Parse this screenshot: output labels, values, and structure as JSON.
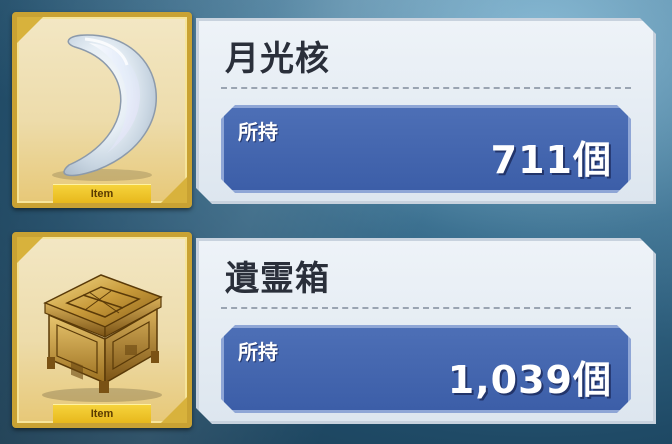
{
  "items": [
    {
      "name": "月光核",
      "tag": "Item",
      "owned_label": "所持",
      "owned_count": "711個",
      "icon": "crescent-moon-crystal-icon"
    },
    {
      "name": "遺霊箱",
      "tag": "Item",
      "owned_label": "所持",
      "owned_count": "1,039個",
      "icon": "golden-chest-icon"
    }
  ],
  "colors": {
    "frame_gold": "#c9a233",
    "owned_panel_blue": "#4d6fb6",
    "tag_yellow": "#f6d33c"
  }
}
